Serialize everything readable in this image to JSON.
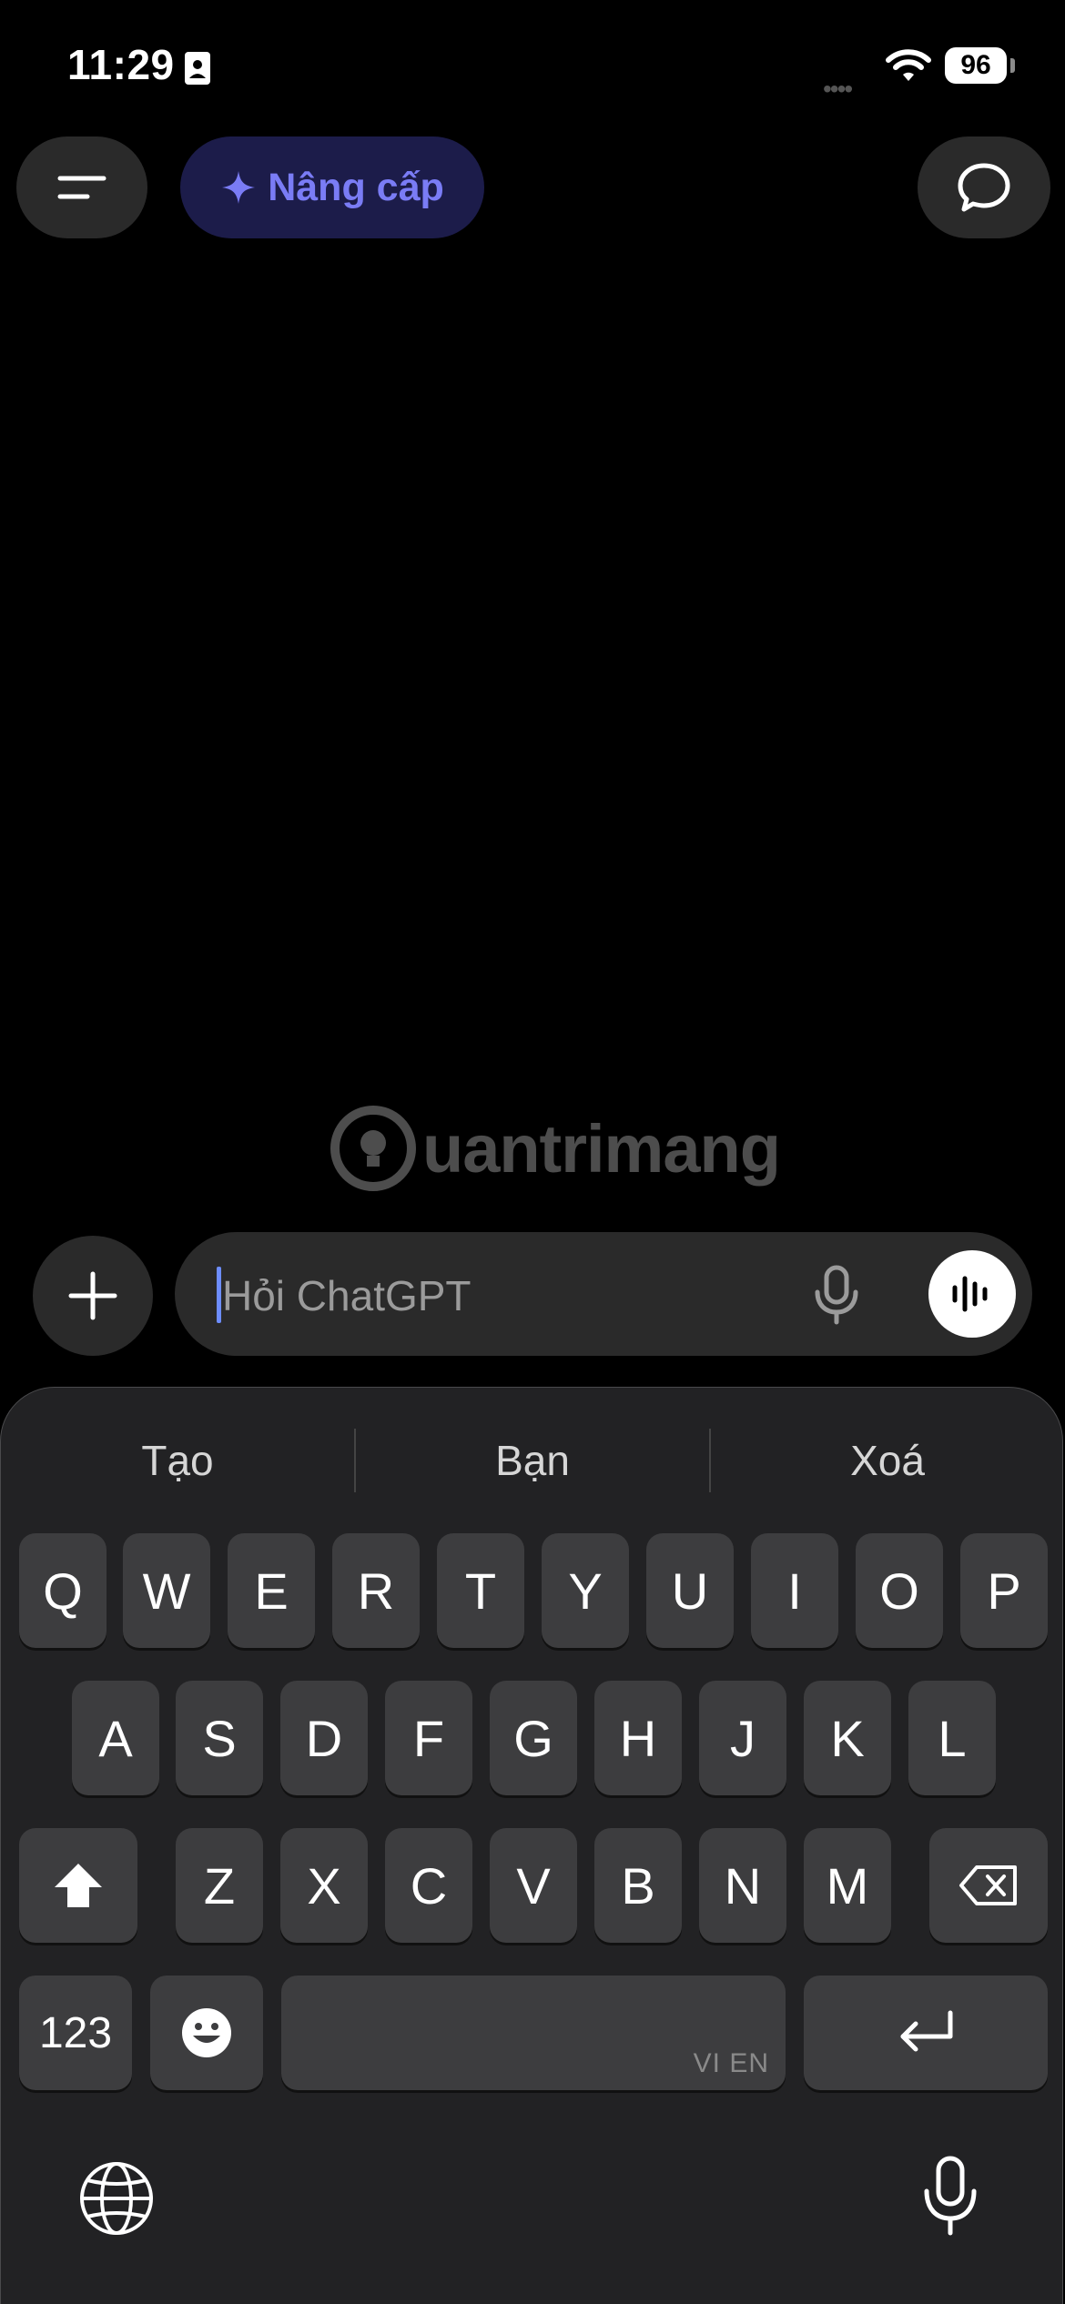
{
  "status_bar": {
    "time": "11:29",
    "battery": "96",
    "signal_dots": "••••"
  },
  "header": {
    "upgrade_label": "Nâng cấp"
  },
  "watermark": {
    "text": "uantrimang"
  },
  "composer": {
    "placeholder": "Hỏi ChatGPT",
    "value": ""
  },
  "keyboard": {
    "suggestions": [
      "Tạo",
      "Bạn",
      "Xoá"
    ],
    "row1": [
      "Q",
      "W",
      "E",
      "R",
      "T",
      "Y",
      "U",
      "I",
      "O",
      "P"
    ],
    "row2": [
      "A",
      "S",
      "D",
      "F",
      "G",
      "H",
      "J",
      "K",
      "L"
    ],
    "row3": [
      "Z",
      "X",
      "C",
      "V",
      "B",
      "N",
      "M"
    ],
    "numbers_label": "123",
    "space_hint": "VI EN"
  },
  "colors": {
    "accent": "#7a7cf5",
    "upgrade_bg": "#1c1c4a",
    "caret": "#6d8dff",
    "key_bg": "#3d3d3f",
    "keyboard_bg": "#222224"
  }
}
